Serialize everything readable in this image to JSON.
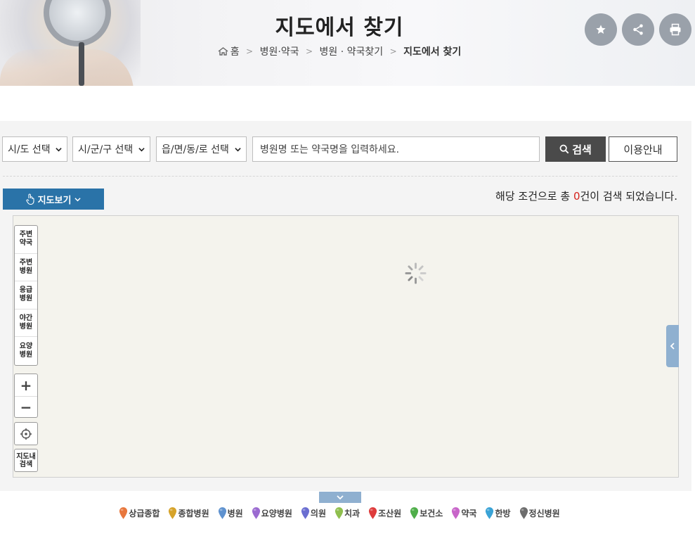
{
  "header": {
    "title": "지도에서 찾기",
    "breadcrumb": {
      "home": "홈",
      "items": [
        "병원·약국",
        "병원 · 약국찾기"
      ],
      "current": "지도에서 찾기"
    },
    "buttons": [
      "favorite",
      "share",
      "print"
    ]
  },
  "search": {
    "sido_select": "시/도 선택",
    "sigungu_select": "시/군/구 선택",
    "emd_select": "읍/면/동/로 선택",
    "input_placeholder": "병원명 또는 약국명을 입력하세요.",
    "search_button": "검색",
    "guide_button": "이용안내"
  },
  "result": {
    "map_view_button": "지도보기",
    "prefix": "해당 조건으로 총 ",
    "count": "0",
    "suffix": "건이 검색 되었습니다."
  },
  "map": {
    "categories": [
      "주변\n약국",
      "주변\n병원",
      "응급\n병원",
      "야간\n병원",
      "요양\n병원"
    ],
    "zoom_in": "+",
    "zoom_out": "−",
    "map_search_button": "지도내\n검색"
  },
  "legend": [
    {
      "label": "상급종합",
      "color": "#e8773d"
    },
    {
      "label": "종합병원",
      "color": "#d6a32a"
    },
    {
      "label": "병원",
      "color": "#5f92cf"
    },
    {
      "label": "요양병원",
      "color": "#9b6bd1"
    },
    {
      "label": "의원",
      "color": "#6a6ed1"
    },
    {
      "label": "치과",
      "color": "#8fbf4e"
    },
    {
      "label": "조산원",
      "color": "#de3c3c"
    },
    {
      "label": "보건소",
      "color": "#4fae4a"
    },
    {
      "label": "약국",
      "color": "#c865c9"
    },
    {
      "label": "한방",
      "color": "#3aa3d6"
    },
    {
      "label": "정신병원",
      "color": "#6d6d6d"
    }
  ]
}
